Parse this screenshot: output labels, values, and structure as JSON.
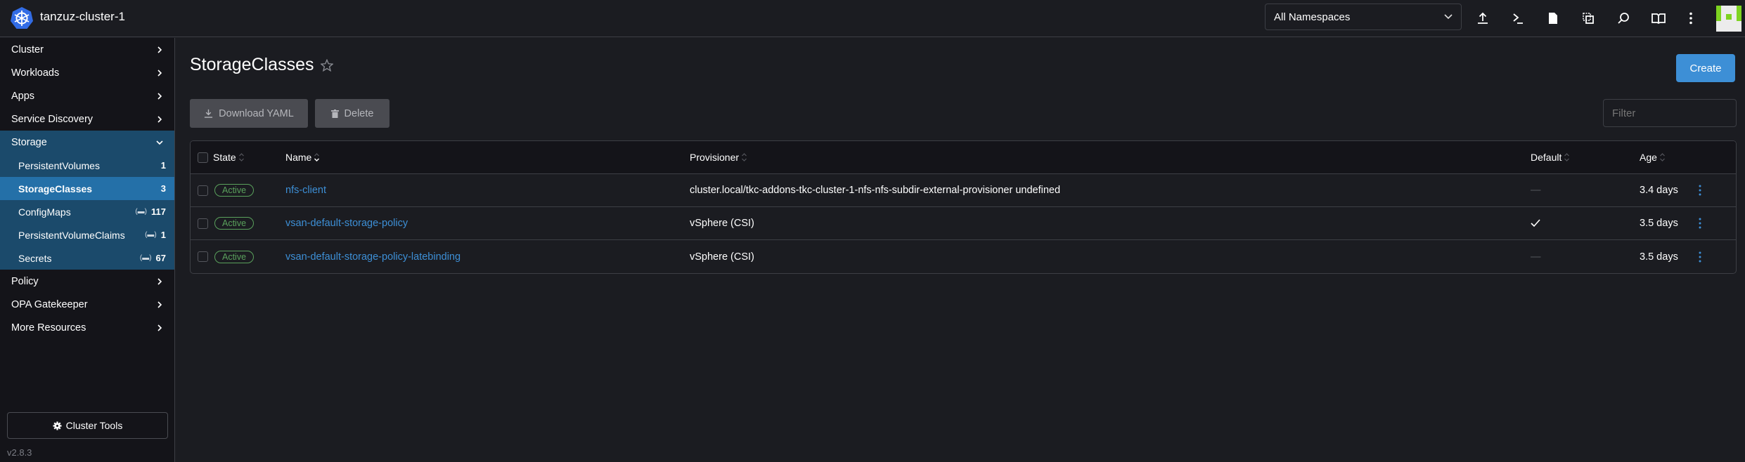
{
  "header": {
    "cluster_name": "tanzuz-cluster-1",
    "namespace_select": "All Namespaces",
    "icons": [
      "upload-icon",
      "terminal-icon",
      "file-icon",
      "copy-kubeconfig-icon",
      "search-icon",
      "book-icon",
      "more-icon"
    ]
  },
  "sidebar": {
    "items": [
      {
        "label": "Cluster"
      },
      {
        "label": "Workloads"
      },
      {
        "label": "Apps"
      },
      {
        "label": "Service Discovery"
      }
    ],
    "storage": {
      "label": "Storage",
      "children": [
        {
          "label": "PersistentVolumes",
          "count": "1",
          "namespaced": false
        },
        {
          "label": "StorageClasses",
          "count": "3",
          "namespaced": false,
          "active": true
        },
        {
          "label": "ConfigMaps",
          "count": "117",
          "namespaced": true
        },
        {
          "label": "PersistentVolumeClaims",
          "count": "1",
          "namespaced": true
        },
        {
          "label": "Secrets",
          "count": "67",
          "namespaced": true
        }
      ]
    },
    "items_after": [
      {
        "label": "Policy"
      },
      {
        "label": "OPA Gatekeeper"
      },
      {
        "label": "More Resources"
      }
    ],
    "cluster_tools": "Cluster Tools",
    "version": "v2.8.3"
  },
  "main": {
    "title": "StorageClasses",
    "create_label": "Create",
    "download_label": "Download YAML",
    "delete_label": "Delete",
    "filter_placeholder": "Filter",
    "columns": [
      "State",
      "Name",
      "Provisioner",
      "Default",
      "Age"
    ],
    "rows": [
      {
        "state": "Active",
        "name": "nfs-client",
        "provisioner": "cluster.local/tkc-addons-tkc-cluster-1-nfs-nfs-subdir-external-provisioner undefined",
        "default": "—",
        "is_default": false,
        "age": "3.4 days"
      },
      {
        "state": "Active",
        "name": "vsan-default-storage-policy",
        "provisioner": "vSphere (CSI)",
        "default": "✓",
        "is_default": true,
        "age": "3.5 days"
      },
      {
        "state": "Active",
        "name": "vsan-default-storage-policy-latebinding",
        "provisioner": "vSphere (CSI)",
        "default": "—",
        "is_default": false,
        "age": "3.5 days"
      }
    ]
  },
  "colors": {
    "accent": "#3d8fd6",
    "active_state": "#5aa15c",
    "sidebar_group": "#1b4a6b",
    "sidebar_active": "#2470a8"
  }
}
